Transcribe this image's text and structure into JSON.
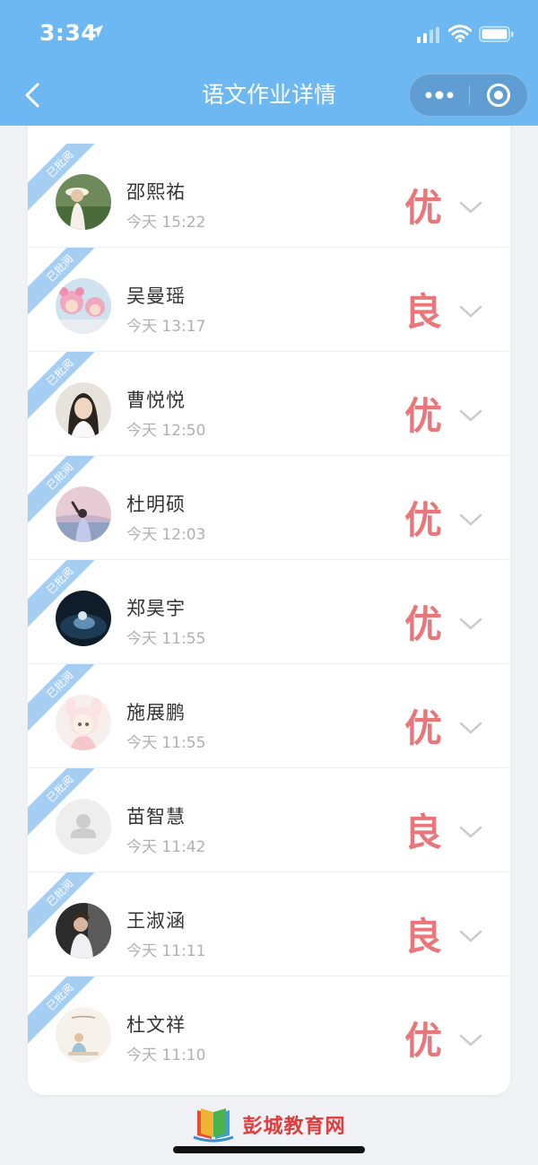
{
  "status_bar": {
    "time": "3:34"
  },
  "header": {
    "title": "语文作业详情"
  },
  "list": {
    "ribbon_label": "已批阅",
    "items": [
      {
        "name": "邵熙祐",
        "time": "今天 15:22",
        "grade": "优"
      },
      {
        "name": "吴曼瑶",
        "time": "今天 13:17",
        "grade": "良"
      },
      {
        "name": "曹悦悦",
        "time": "今天 12:50",
        "grade": "优"
      },
      {
        "name": "杜明硕",
        "time": "今天 12:03",
        "grade": "优"
      },
      {
        "name": "郑昊宇",
        "time": "今天 11:55",
        "grade": "优"
      },
      {
        "name": "施展鹏",
        "time": "今天 11:55",
        "grade": "优"
      },
      {
        "name": "苗智慧",
        "time": "今天 11:42",
        "grade": "良"
      },
      {
        "name": "王淑涵",
        "time": "今天 11:11",
        "grade": "良"
      },
      {
        "name": "杜文祥",
        "time": "今天 11:10",
        "grade": "优"
      }
    ]
  },
  "watermark": {
    "text": "彭城教育网"
  },
  "colors": {
    "header": "#6db8f2",
    "grade": "#e8767a",
    "ribbon": "#a6cdf2"
  }
}
